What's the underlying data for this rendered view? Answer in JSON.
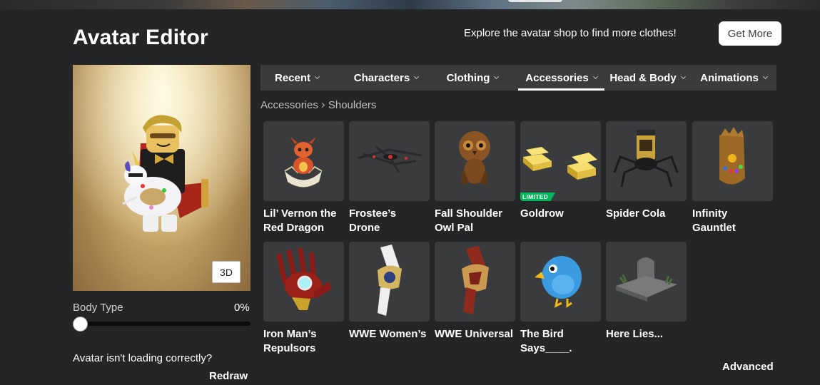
{
  "header": {
    "title": "Avatar Editor",
    "promo_text": "Explore the avatar shop to find more clothes!",
    "get_more_label": "Get More"
  },
  "preview": {
    "btn_3d_label": "3D"
  },
  "body_type": {
    "label": "Body Type",
    "value_text": "0%",
    "value": 0
  },
  "loading": {
    "question": "Avatar isn't loading correctly?",
    "redraw_label": "Redraw"
  },
  "tabs": [
    {
      "label": "Recent",
      "active": false
    },
    {
      "label": "Characters",
      "active": false
    },
    {
      "label": "Clothing",
      "active": false
    },
    {
      "label": "Accessories",
      "active": true
    },
    {
      "label": "Head & Body",
      "active": false
    },
    {
      "label": "Animations",
      "active": false
    }
  ],
  "breadcrumb": {
    "parent": "Accessories",
    "current": "Shoulders"
  },
  "items": [
    {
      "name": "Lil’ Vernon the Red Dragon",
      "icon": "red-dragon-icon"
    },
    {
      "name": "Frostee’s Drone",
      "icon": "drone-icon"
    },
    {
      "name": "Fall Shoulder Owl Pal",
      "icon": "owl-icon"
    },
    {
      "name": "Goldrow",
      "icon": "gold-bars-icon",
      "badge": "LIMITED"
    },
    {
      "name": "Spider Cola",
      "icon": "spider-cola-icon"
    },
    {
      "name": "Infinity Gauntlet",
      "icon": "gauntlet-icon"
    },
    {
      "name": "Iron Man’s Repulsors",
      "icon": "repulsor-glove-icon"
    },
    {
      "name": "WWE Women’s",
      "icon": "championship-belt-icon"
    },
    {
      "name": "WWE Universal",
      "icon": "championship-belt-icon"
    },
    {
      "name": "The Bird Says____.",
      "icon": "blue-bird-icon"
    },
    {
      "name": "Here Lies...",
      "icon": "tombstone-icon"
    }
  ],
  "footer": {
    "advanced_label": "Advanced"
  },
  "colors": {
    "background": "#232527",
    "panel": "#393b3d",
    "limited_badge": "#02b757"
  }
}
